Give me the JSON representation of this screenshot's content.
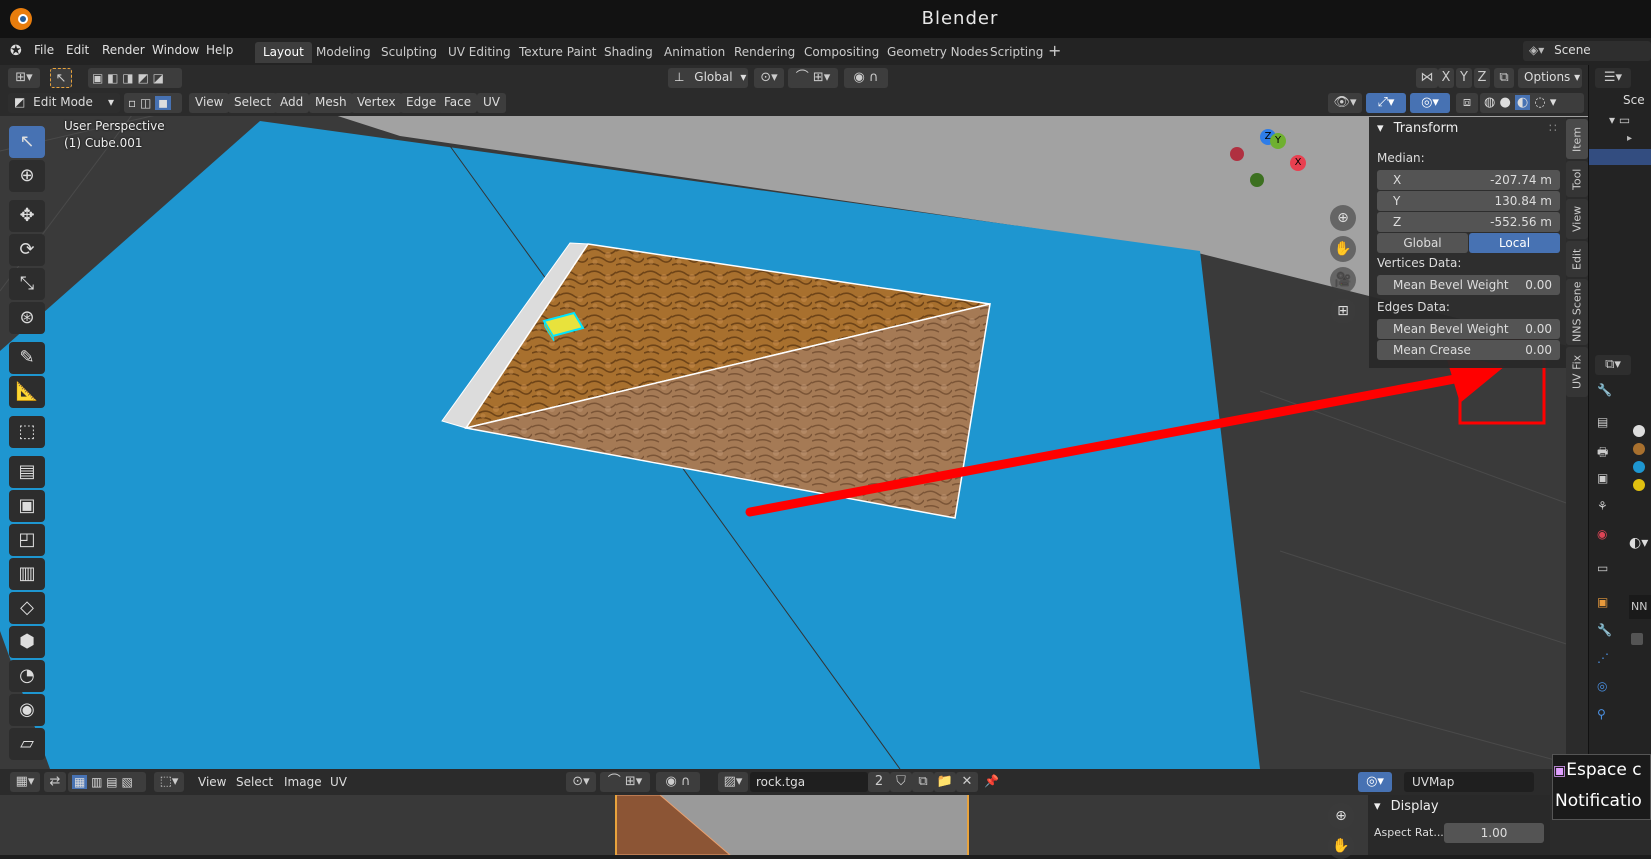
{
  "app": {
    "title": "Blender"
  },
  "menus": [
    "File",
    "Edit",
    "Render",
    "Window",
    "Help"
  ],
  "workspaces": [
    "Layout",
    "Modeling",
    "Sculpting",
    "UV Editing",
    "Texture Paint",
    "Shading",
    "Animation",
    "Rendering",
    "Compositing",
    "Geometry Nodes",
    "Scripting"
  ],
  "active_workspace": "Layout",
  "scene_name": "Scene",
  "header1": {
    "orientation": "Global",
    "axes": [
      "X",
      "Y",
      "Z"
    ],
    "options": "Options"
  },
  "header2": {
    "mode": "Edit Mode",
    "menus": [
      "View",
      "Select",
      "Add",
      "Mesh",
      "Vertex",
      "Edge",
      "Face",
      "UV"
    ]
  },
  "viewport": {
    "perspective": "User Perspective",
    "object": "(1) Cube.001",
    "gizmo": {
      "z": "Z",
      "y": "Y",
      "x": "X"
    }
  },
  "npanel": {
    "section": "Transform",
    "median_label": "Median:",
    "fields": [
      {
        "label": "X",
        "value": "-207.74 m"
      },
      {
        "label": "Y",
        "value": "130.84 m"
      },
      {
        "label": "Z",
        "value": "-552.56 m"
      }
    ],
    "space_options": [
      "Global",
      "Local"
    ],
    "active_space": "Local",
    "vertices_label": "Vertices Data:",
    "vertex_fields": [
      {
        "label": "Mean Bevel Weight",
        "value": "0.00"
      }
    ],
    "edges_label": "Edges Data:",
    "edge_fields": [
      {
        "label": "Mean Bevel Weight",
        "value": "0.00"
      },
      {
        "label": "Mean Crease",
        "value": "0.00"
      }
    ]
  },
  "sidebar_tabs": [
    "Item",
    "Tool",
    "View",
    "Edit",
    "NNS Scene",
    "UV Fix"
  ],
  "uv_editor": {
    "menus": [
      "View",
      "Select",
      "Image",
      "UV"
    ],
    "image_name": "rock.tga",
    "users": "2",
    "uvmap": "UVMap",
    "display_section": "Display",
    "aspect_label": "Aspect Rat...",
    "aspect_value": "1.00"
  },
  "notification": {
    "line1": "Espace c",
    "line2": "Notificatio"
  },
  "right_panel": {
    "scene_short": "Sce",
    "nn_short": "NN"
  },
  "colors": {
    "accent": "#4772b3",
    "viewport_bg": "#1e96d0",
    "annotation": "#ff0000"
  }
}
